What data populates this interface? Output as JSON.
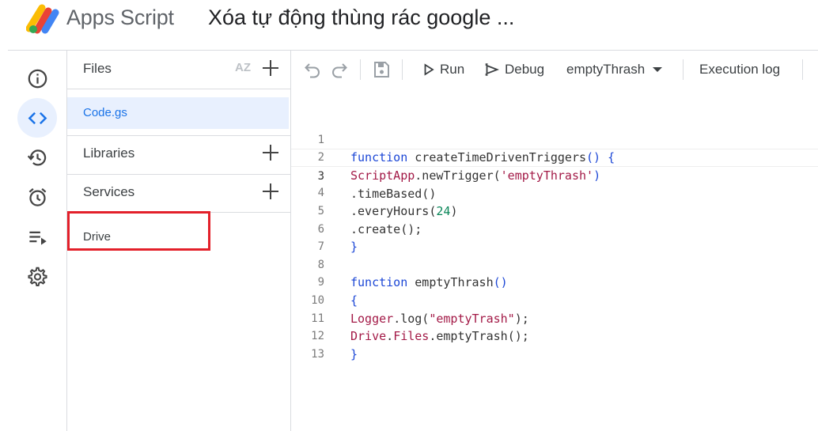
{
  "header": {
    "app_name": "Apps Script",
    "project_title": "Xóa tự động thùng rác google ..."
  },
  "rail": {
    "items": [
      {
        "icon": "info-icon",
        "label": "Overview"
      },
      {
        "icon": "code-icon",
        "label": "Editor",
        "active": true
      },
      {
        "icon": "history-icon",
        "label": "Project History"
      },
      {
        "icon": "alarm-icon",
        "label": "Triggers"
      },
      {
        "icon": "executions-icon",
        "label": "Executions"
      },
      {
        "icon": "gear-icon",
        "label": "Project Settings"
      }
    ]
  },
  "files_panel": {
    "files_title": "Files",
    "sort_label": "AZ",
    "files": [
      "Code.gs"
    ],
    "libraries_title": "Libraries",
    "services_title": "Services",
    "services": [
      "Drive"
    ]
  },
  "toolbar": {
    "run_label": "Run",
    "debug_label": "Debug",
    "function_select": "emptyThrash",
    "execution_log_label": "Execution log"
  },
  "editor": {
    "current_line": 3,
    "lines": [
      {
        "num": "1"
      },
      {
        "num": "2"
      },
      {
        "num": "3"
      },
      {
        "num": "4"
      },
      {
        "num": "5"
      },
      {
        "num": "6"
      },
      {
        "num": "7"
      },
      {
        "num": "8"
      },
      {
        "num": "9"
      },
      {
        "num": "10"
      },
      {
        "num": "11"
      },
      {
        "num": "12"
      },
      {
        "num": "13"
      }
    ],
    "tokens": {
      "l1_kw": "function",
      "l1_fn": " createTimeDrivenTriggers",
      "l1_rest": "() {",
      "l2_cls": "ScriptApp",
      "l2_fn": ".newTrigger(",
      "l2_str": "'emptyThrash'",
      "l2_close": ")",
      "l3": ".timeBased()",
      "l4_fn": ".everyHours(",
      "l4_num": "24",
      "l4_close": ")",
      "l5": ".create();",
      "l6": "}",
      "l8_kw": "function",
      "l8_fn": " emptyThrash",
      "l8_rest": "()",
      "l9": "{",
      "l10_cls": "Logger",
      "l10_fn": ".log(",
      "l10_str": "\"emptyTrash\"",
      "l10_close": ");",
      "l11_cls": "Drive",
      "l11_dot": ".",
      "l11_cls2": "Files",
      "l11_fn": ".emptyTrash",
      "l11_close": "();",
      "l12": "}"
    }
  },
  "colors": {
    "accent": "#1a73e8",
    "highlight_border": "#e3202a",
    "active_bg": "#e8f0fe"
  }
}
